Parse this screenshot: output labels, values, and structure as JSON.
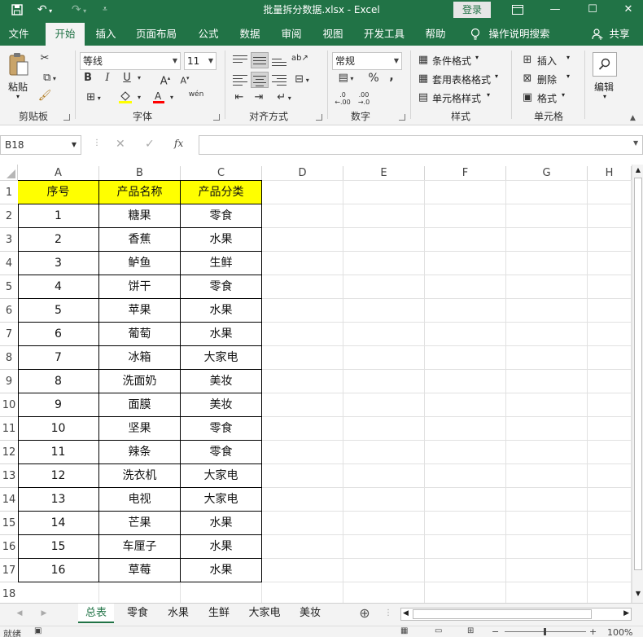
{
  "titlebar": {
    "title": "批量拆分数据.xlsx  -  Excel",
    "login": "登录",
    "accent": "#217346"
  },
  "ribbon_tabs": [
    {
      "label": "文件"
    },
    {
      "label": "开始"
    },
    {
      "label": "插入"
    },
    {
      "label": "页面布局"
    },
    {
      "label": "公式"
    },
    {
      "label": "数据"
    },
    {
      "label": "审阅"
    },
    {
      "label": "视图"
    },
    {
      "label": "开发工具"
    },
    {
      "label": "帮助"
    },
    {
      "label": "操作说明搜索"
    },
    {
      "label": "共享"
    }
  ],
  "ribbon": {
    "clipboard": {
      "paste": "粘贴",
      "group": "剪贴板"
    },
    "font": {
      "name": "等线",
      "size": "11",
      "group": "字体",
      "bold": "B",
      "italic": "I",
      "underline": "U",
      "pinyin": "wén"
    },
    "alignment": {
      "group": "对齐方式"
    },
    "number": {
      "format": "常规",
      "group": "数字",
      "percent": "%",
      "comma": ","
    },
    "styles": {
      "conditional": "条件格式",
      "table": "套用表格格式",
      "cell": "单元格样式",
      "group": "样式"
    },
    "cells": {
      "insert": "插入",
      "delete": "删除",
      "format": "格式",
      "group": "单元格"
    },
    "editing": {
      "label": "编辑"
    }
  },
  "formula_bar": {
    "name_box": "B18",
    "fx": "fx",
    "value": ""
  },
  "columns": [
    "A",
    "B",
    "C",
    "D",
    "E",
    "F",
    "G",
    "H"
  ],
  "rows": [
    "1",
    "2",
    "3",
    "4",
    "5",
    "6",
    "7",
    "8",
    "9",
    "10",
    "11",
    "12",
    "13",
    "14",
    "15",
    "16",
    "17",
    "18"
  ],
  "table": {
    "headers": [
      "序号",
      "产品名称",
      "产品分类"
    ],
    "rows": [
      [
        "1",
        "糖果",
        "零食"
      ],
      [
        "2",
        "香蕉",
        "水果"
      ],
      [
        "3",
        "鲈鱼",
        "生鲜"
      ],
      [
        "4",
        "饼干",
        "零食"
      ],
      [
        "5",
        "苹果",
        "水果"
      ],
      [
        "6",
        "葡萄",
        "水果"
      ],
      [
        "7",
        "冰箱",
        "大家电"
      ],
      [
        "8",
        "洗面奶",
        "美妆"
      ],
      [
        "9",
        "面膜",
        "美妆"
      ],
      [
        "10",
        "坚果",
        "零食"
      ],
      [
        "11",
        "辣条",
        "零食"
      ],
      [
        "12",
        "洗衣机",
        "大家电"
      ],
      [
        "13",
        "电视",
        "大家电"
      ],
      [
        "14",
        "芒果",
        "水果"
      ],
      [
        "15",
        "车厘子",
        "水果"
      ],
      [
        "16",
        "草莓",
        "水果"
      ]
    ],
    "header_color": "#ffff00"
  },
  "sheet_tabs": [
    {
      "label": "总表"
    },
    {
      "label": "零食"
    },
    {
      "label": "水果"
    },
    {
      "label": "生鲜"
    },
    {
      "label": "大家电"
    },
    {
      "label": "美妆"
    }
  ],
  "statusbar": {
    "status": "就绪",
    "zoom": "100%"
  }
}
